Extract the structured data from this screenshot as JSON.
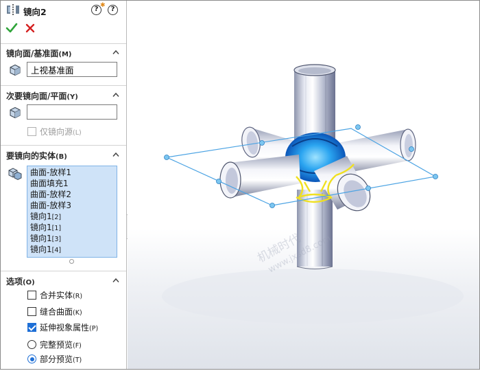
{
  "feature": {
    "title": "镜向2",
    "help_label": "?",
    "help2_label": "?"
  },
  "icons": {
    "feature": "mirror-feature-icon",
    "ok": "checkmark-icon",
    "cancel": "close-icon",
    "cube": "cube-icon",
    "bodies": "solid-bodies-icon",
    "collapse": "chevron-up-icon"
  },
  "colors": {
    "ok_green": "#2fa43a",
    "cancel_red": "#d42020",
    "accent_blue": "#1e6fd6",
    "list_bg": "#cfe3f8",
    "edge_yellow": "#f0e020",
    "plane_blue": "#4ba3e3"
  },
  "sections": {
    "mirror_face": {
      "title": "镜向面/基准面",
      "shortcut": "(M)",
      "value": "上视基准面"
    },
    "secondary_face": {
      "title": "次要镜向面/平面",
      "shortcut": "(Y)",
      "value": "",
      "mirror_seed_label": "仅镜向源",
      "mirror_seed_shortcut": "(L)",
      "mirror_seed_checked": false
    },
    "bodies": {
      "title": "要镜向的实体",
      "shortcut": "(B)",
      "items": [
        {
          "text": "曲面-放样1",
          "sub": ""
        },
        {
          "text": "曲面填充1",
          "sub": ""
        },
        {
          "text": "曲面-放样2",
          "sub": ""
        },
        {
          "text": "曲面-放样3",
          "sub": ""
        },
        {
          "text": "镜向1",
          "sub": "[2]"
        },
        {
          "text": "镜向1",
          "sub": "[1]"
        },
        {
          "text": "镜向1",
          "sub": "[3]"
        },
        {
          "text": "镜向1",
          "sub": "[4]"
        }
      ]
    },
    "options": {
      "title": "选项",
      "shortcut": "(O)",
      "merge_solids": {
        "label": "合并实体",
        "shortcut": "(R)",
        "checked": false
      },
      "knit_surfaces": {
        "label": "缝合曲面",
        "shortcut": "(K)",
        "checked": false
      },
      "propagate_visual": {
        "label": "延伸视象属性",
        "shortcut": "(P)",
        "checked": true
      },
      "full_preview": {
        "label": "完整预览",
        "shortcut": "(F)",
        "selected": false
      },
      "partial_preview": {
        "label": "部分预览",
        "shortcut": "(T)",
        "selected": true
      }
    }
  },
  "watermark": {
    "line1": "机械时代",
    "line2": "www.jxsd8.com"
  }
}
